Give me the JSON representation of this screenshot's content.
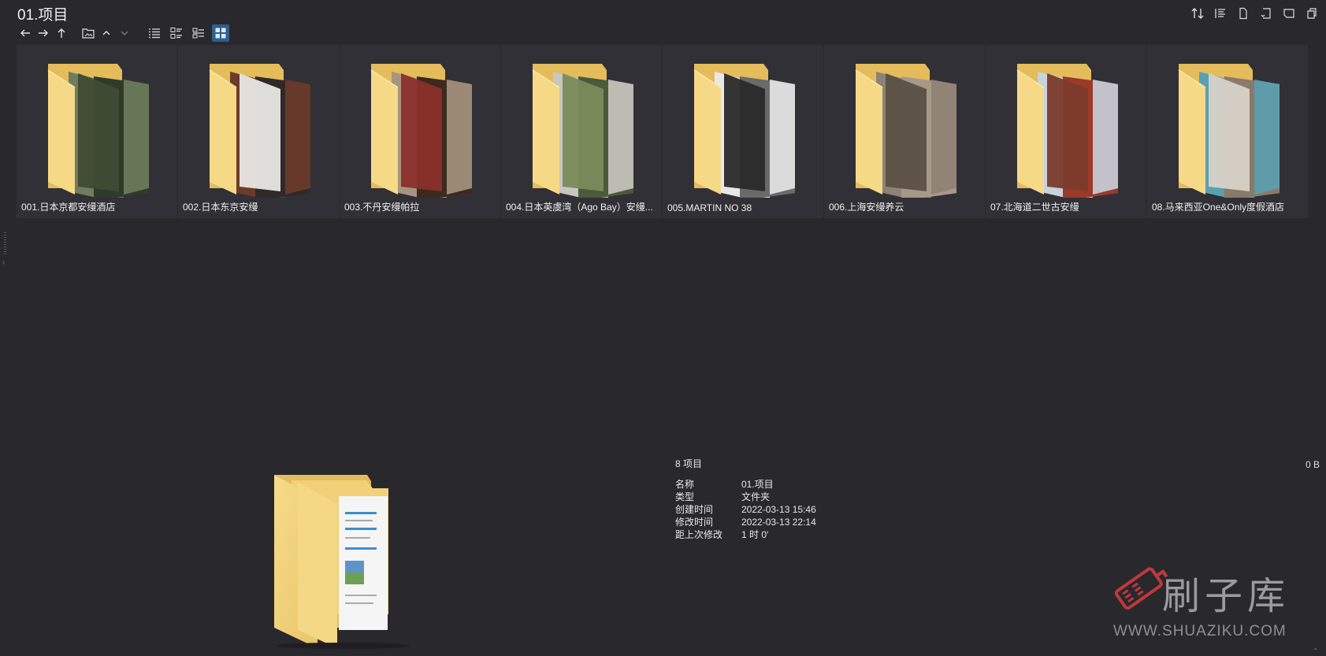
{
  "window": {
    "title": "01.项目"
  },
  "toolbar": {
    "top_right_icons": [
      "sort-icon",
      "list-details-icon",
      "file-icon",
      "rotate-icon",
      "panel-icon",
      "copy-icon"
    ],
    "nav_icons": [
      "back-arrow-icon",
      "forward-arrow-icon",
      "up-arrow-icon",
      "folder-picture-icon",
      "chevron-up-icon",
      "chevron-down-icon"
    ],
    "view_icons": [
      "list-view-icon",
      "details-view-icon",
      "tiles-view-icon",
      "thumbnail-view-icon"
    ],
    "active_view": "thumbnail-view-icon"
  },
  "folders": [
    {
      "label": "001.日本京都安缦酒店",
      "colors": [
        "#3f4b32",
        "#6f7d5d",
        "#2f3a2a"
      ]
    },
    {
      "label": "002.日本东京安缦",
      "colors": [
        "#e9e7e4",
        "#6d3b2a",
        "#2f2a28"
      ]
    },
    {
      "label": "003.不丹安缦帕拉",
      "colors": [
        "#8b2f2a",
        "#a69580",
        "#3c2a1f"
      ]
    },
    {
      "label": "004.日本英虞湾（Ago Bay）安缦...",
      "colors": [
        "#7a8b5a",
        "#c9c6c0",
        "#4a5a3a"
      ]
    },
    {
      "label": "005.MARTIN NO 38",
      "colors": [
        "#2a2a2a",
        "#e8e8e8",
        "#6a6a6a"
      ]
    },
    {
      "label": "006.上海安缦养云",
      "colors": [
        "#5b5045",
        "#8e8276",
        "#a89888"
      ]
    },
    {
      "label": "07.北海道二世古安缦",
      "colors": [
        "#7b3b2b",
        "#c8d2dc",
        "#9a3a2a"
      ]
    },
    {
      "label": "08.马来西亚One&Only度假酒店",
      "colors": [
        "#d8d2c8",
        "#5aa0b0",
        "#8a7a6a"
      ]
    }
  ],
  "info": {
    "count": "8 项目",
    "rows": [
      {
        "key": "名称",
        "value": "01.项目"
      },
      {
        "key": "类型",
        "value": "文件夹"
      },
      {
        "key": "创建时间",
        "value": "2022-03-13  15:46"
      },
      {
        "key": "修改时间",
        "value": "2022-03-13  22:14"
      },
      {
        "key": "距上次修改",
        "value": "1 时 0′"
      }
    ],
    "size": "0 B"
  },
  "watermark": {
    "text": "刷子库",
    "url": "WWW.SHUAZIKU.COM"
  },
  "colors": {
    "background": "#29282d",
    "tile": "#313036",
    "folder": "#f3d27a",
    "folder_dark": "#e4bc5c",
    "accent": "#2f5f8e"
  }
}
